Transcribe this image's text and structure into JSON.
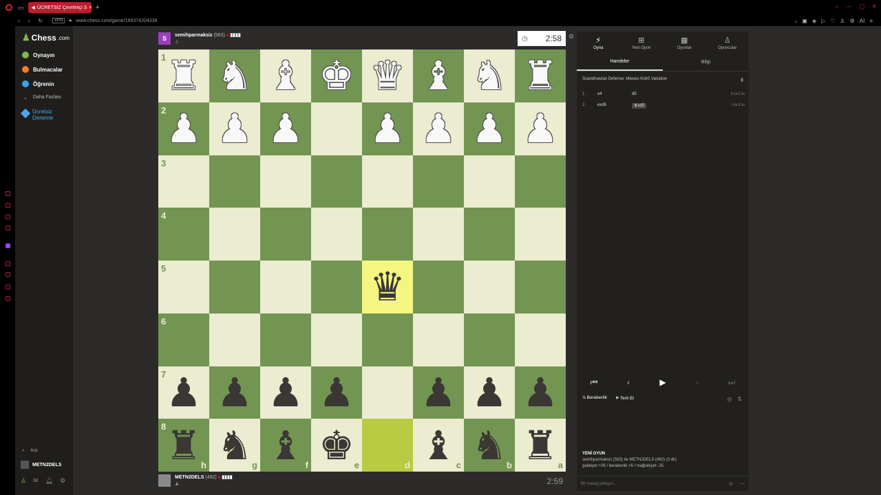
{
  "browser": {
    "tab_title": "ÜCRETSİZ Çevrimiçi S",
    "tab_close": "×",
    "tab_add": "+",
    "vpn": "VPN",
    "url": "www.chess.com/game/165374204338",
    "ai_label": "AI"
  },
  "leftnav": {
    "logo_text": "Chess",
    "logo_suffix": ".com",
    "items": [
      {
        "label": "Oynayın",
        "color": "#81b64c"
      },
      {
        "label": "Bulmacalar",
        "color": "#f07b2a"
      },
      {
        "label": "Öğrenin",
        "color": "#3ba3e6"
      }
    ],
    "more": "Daha Fazlası",
    "trial": "Ücretsiz Deneme",
    "search": "Ara",
    "username": "METN2DELS"
  },
  "top_player": {
    "avatar_letter": "S",
    "name": "semihparmaksiz",
    "rating": "(563)",
    "clock": "2:58"
  },
  "bottom_player": {
    "name": "METN2DELS",
    "rating": "(492)",
    "clock": "2:59"
  },
  "board": {
    "ranks": [
      "1",
      "2",
      "3",
      "4",
      "5",
      "6",
      "7",
      "8"
    ],
    "files": [
      "h",
      "g",
      "f",
      "e",
      "d",
      "c",
      "b",
      "a"
    ],
    "rows": [
      [
        "wR",
        "wN",
        "wB",
        "wK",
        "wQ",
        "wB",
        "wN",
        "wR"
      ],
      [
        "wP",
        "wP",
        "wP",
        "",
        "wP",
        "wP",
        "wP",
        "wP"
      ],
      [
        "",
        "",
        "",
        "",
        "",
        "",
        "",
        ""
      ],
      [
        "",
        "",
        "",
        "",
        "",
        "",
        "",
        ""
      ],
      [
        "",
        "",
        "",
        "",
        "bQ",
        "",
        "",
        ""
      ],
      [
        "",
        "",
        "",
        "",
        "",
        "",
        "",
        ""
      ],
      [
        "bP",
        "bP",
        "bP",
        "bP",
        "",
        "bP",
        "bP",
        "bP"
      ],
      [
        "bR",
        "bN",
        "bB",
        "bK",
        "",
        "bB",
        "bN",
        "bR"
      ]
    ],
    "highlight": [
      [
        4,
        4
      ],
      [
        7,
        4
      ]
    ]
  },
  "panel": {
    "tabs": [
      {
        "label": "Oyna",
        "icon": "lightning-icon"
      },
      {
        "label": "Yeni Oyun",
        "icon": "plus-icon"
      },
      {
        "label": "Oyunlar",
        "icon": "board-icon"
      },
      {
        "label": "Oyuncular",
        "icon": "players-icon"
      }
    ],
    "subtabs": [
      "Hamleler",
      "Bilgi"
    ],
    "opening": "Scandinavian Defense: Mieses-Kotrč Variation",
    "moves": [
      {
        "num": "1.",
        "white": "e4",
        "black": "d5",
        "times": "0.1s 0.1s"
      },
      {
        "num": "2.",
        "white": "exd5",
        "black": "♛xd5",
        "times": "1.4s 0.1s"
      }
    ],
    "draw": "Beraberlik",
    "resign": "Terk Et",
    "newgame_title": "YENİ OYUN",
    "newgame_line1": "semihparmaksiz (563) ile METN2DELS (492) (3 dk)",
    "newgame_line2": "galibiyet +36 / beraberlik +6 / mağlubiyet -25",
    "chat_placeholder": "Bir mesaj yollayın..."
  }
}
